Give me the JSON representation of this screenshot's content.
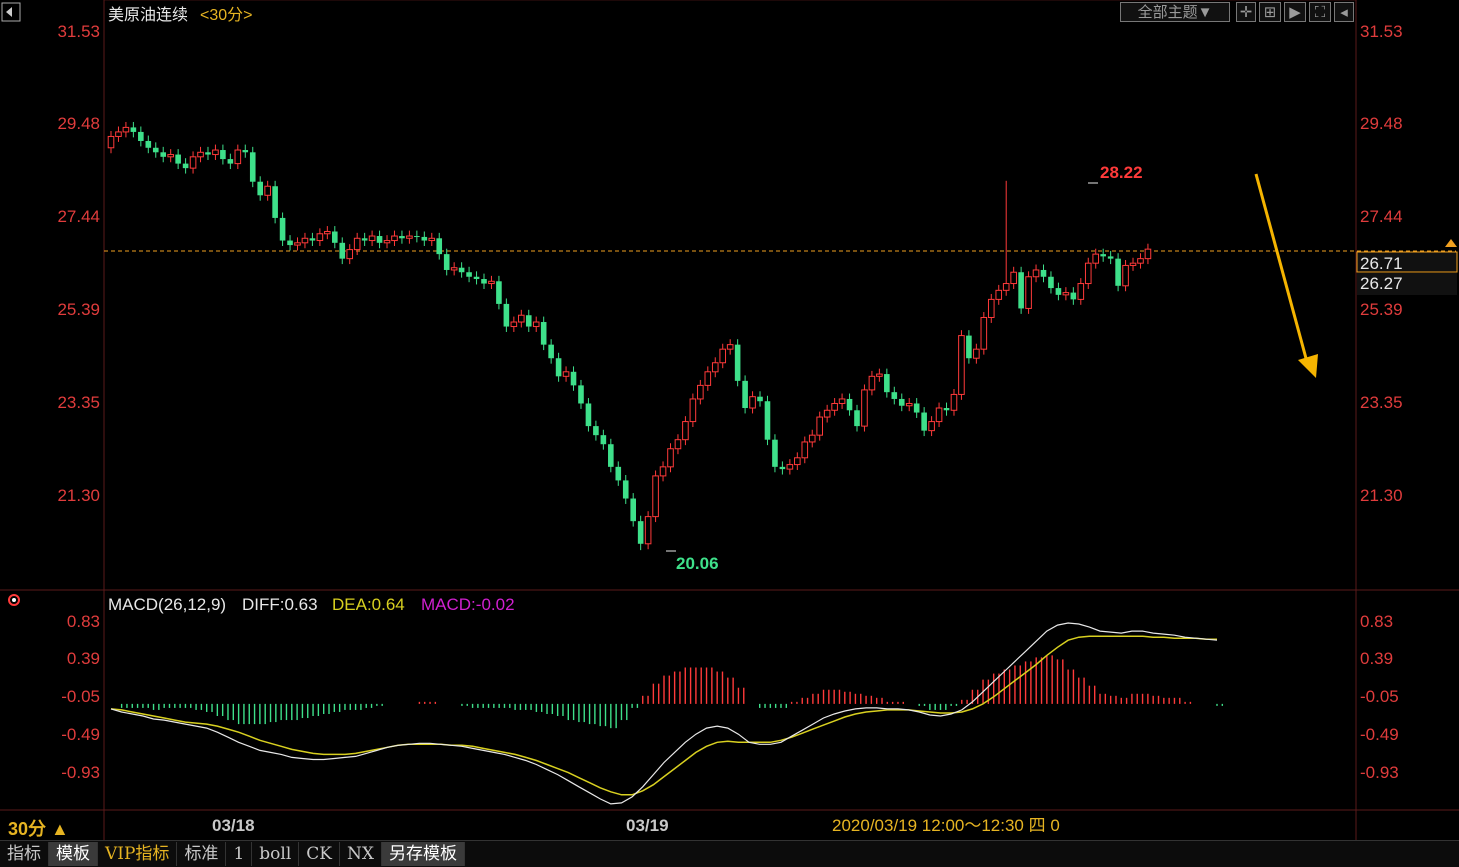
{
  "header": {
    "title": "美原油连续",
    "period_tag": "<30分>",
    "theme_button": "全部主题▼"
  },
  "macd_legend": {
    "name": "MACD(26,12,9)",
    "diff": "DIFF:0.63",
    "dea": "DEA:0.64",
    "macd": "MACD:-0.02"
  },
  "bottom": {
    "period": "30分 ▲",
    "date_label_1": "03/18",
    "date_label_2": "03/19",
    "cursor_info": "2020/03/19 12:00～12:30 四 0"
  },
  "tabs": [
    "指标",
    "模板",
    "VIP指标",
    "标准",
    "1",
    "boll",
    "CK",
    "NX",
    "另存模板"
  ],
  "price_axis": {
    "ticks": [
      "31.53",
      "29.48",
      "27.44",
      "25.39",
      "23.35",
      "21.30"
    ],
    "last_price": "26.71",
    "current_price": "26.27"
  },
  "macd_axis": {
    "ticks": [
      "0.83",
      "0.39",
      "-0.05",
      "-0.49",
      "-0.93"
    ]
  },
  "annotations": {
    "high_label": "28.22",
    "low_label": "20.06"
  },
  "colors": {
    "up": "#ff3a3a",
    "down": "#3ee08a",
    "axis_text": "#e03c3c",
    "accent": "#f0a020",
    "dea": "#d8d020",
    "diff": "#e8e8e8",
    "macd_text": "#d020d0"
  },
  "chart_data": {
    "type": "candlestick",
    "price_range": [
      19.5,
      31.53
    ],
    "macd_range": [
      -1.05,
      0.83
    ],
    "reference_price": 26.71,
    "high": 28.22,
    "low": 20.06,
    "closes": [
      29.2,
      29.3,
      29.4,
      29.3,
      29.1,
      28.95,
      28.85,
      28.75,
      28.8,
      28.6,
      28.5,
      28.75,
      28.85,
      28.8,
      28.9,
      28.7,
      28.6,
      28.9,
      28.85,
      28.2,
      27.9,
      28.1,
      27.4,
      26.9,
      26.8,
      26.85,
      26.95,
      26.9,
      27.05,
      27.1,
      26.85,
      26.5,
      26.7,
      26.95,
      26.9,
      27.0,
      26.85,
      26.9,
      27.0,
      26.95,
      27.0,
      26.98,
      26.9,
      26.95,
      26.6,
      26.25,
      26.3,
      26.2,
      26.1,
      26.05,
      25.95,
      26.0,
      25.5,
      25.0,
      25.1,
      25.25,
      25.0,
      25.1,
      24.6,
      24.3,
      23.9,
      24.0,
      23.7,
      23.3,
      22.8,
      22.6,
      22.4,
      21.9,
      21.6,
      21.2,
      20.7,
      20.2,
      20.8,
      21.7,
      21.9,
      22.3,
      22.5,
      22.9,
      23.4,
      23.7,
      24.0,
      24.2,
      24.5,
      24.6,
      23.8,
      23.2,
      23.45,
      23.35,
      22.5,
      21.9,
      21.85,
      21.95,
      22.1,
      22.45,
      22.6,
      23.0,
      23.15,
      23.3,
      23.4,
      23.15,
      22.8,
      23.6,
      23.9,
      23.95,
      23.55,
      23.4,
      23.25,
      23.3,
      23.1,
      22.7,
      22.9,
      23.2,
      23.15,
      23.5,
      24.8,
      24.3,
      24.5,
      25.2,
      25.6,
      25.8,
      25.95,
      26.2,
      25.4,
      26.1,
      26.25,
      26.1,
      25.85,
      25.7,
      25.75,
      25.6,
      25.95,
      26.4,
      26.6,
      26.55,
      26.5,
      25.9,
      26.35,
      26.4,
      26.5,
      26.71
    ],
    "diff": [
      -0.05,
      -0.08,
      -0.1,
      -0.12,
      -0.15,
      -0.16,
      -0.18,
      -0.2,
      -0.22,
      -0.24,
      -0.28,
      -0.33,
      -0.38,
      -0.42,
      -0.46,
      -0.48,
      -0.5,
      -0.53,
      -0.54,
      -0.55,
      -0.55,
      -0.54,
      -0.53,
      -0.52,
      -0.49,
      -0.46,
      -0.43,
      -0.41,
      -0.4,
      -0.39,
      -0.39,
      -0.4,
      -0.41,
      -0.42,
      -0.44,
      -0.46,
      -0.48,
      -0.5,
      -0.53,
      -0.56,
      -0.6,
      -0.65,
      -0.7,
      -0.76,
      -0.82,
      -0.88,
      -0.94,
      -0.99,
      -0.98,
      -0.92,
      -0.82,
      -0.7,
      -0.58,
      -0.48,
      -0.38,
      -0.3,
      -0.24,
      -0.22,
      -0.24,
      -0.3,
      -0.38,
      -0.4,
      -0.4,
      -0.38,
      -0.32,
      -0.26,
      -0.2,
      -0.14,
      -0.1,
      -0.07,
      -0.05,
      -0.04,
      -0.04,
      -0.05,
      -0.05,
      -0.06,
      -0.08,
      -0.11,
      -0.12,
      -0.1,
      -0.06,
      0.02,
      0.12,
      0.22,
      0.32,
      0.42,
      0.52,
      0.62,
      0.72,
      0.78,
      0.8,
      0.79,
      0.76,
      0.72,
      0.71,
      0.7,
      0.72,
      0.72,
      0.7,
      0.69,
      0.68,
      0.66,
      0.65,
      0.64,
      0.63
    ],
    "dea": [
      -0.05,
      -0.06,
      -0.08,
      -0.1,
      -0.12,
      -0.14,
      -0.16,
      -0.18,
      -0.19,
      -0.2,
      -0.22,
      -0.25,
      -0.28,
      -0.32,
      -0.36,
      -0.39,
      -0.42,
      -0.45,
      -0.47,
      -0.49,
      -0.5,
      -0.5,
      -0.5,
      -0.49,
      -0.47,
      -0.45,
      -0.43,
      -0.41,
      -0.4,
      -0.4,
      -0.4,
      -0.4,
      -0.41,
      -0.41,
      -0.42,
      -0.44,
      -0.46,
      -0.48,
      -0.5,
      -0.53,
      -0.56,
      -0.6,
      -0.64,
      -0.68,
      -0.73,
      -0.78,
      -0.83,
      -0.87,
      -0.9,
      -0.9,
      -0.86,
      -0.8,
      -0.72,
      -0.64,
      -0.56,
      -0.48,
      -0.42,
      -0.38,
      -0.37,
      -0.38,
      -0.38,
      -0.38,
      -0.38,
      -0.36,
      -0.33,
      -0.29,
      -0.25,
      -0.21,
      -0.17,
      -0.13,
      -0.1,
      -0.08,
      -0.07,
      -0.06,
      -0.06,
      -0.06,
      -0.07,
      -0.08,
      -0.09,
      -0.09,
      -0.08,
      -0.05,
      0.0,
      0.07,
      0.15,
      0.23,
      0.31,
      0.39,
      0.48,
      0.56,
      0.63,
      0.66,
      0.67,
      0.67,
      0.67,
      0.67,
      0.67,
      0.67,
      0.66,
      0.66,
      0.65,
      0.65,
      0.65,
      0.64,
      0.64
    ]
  }
}
